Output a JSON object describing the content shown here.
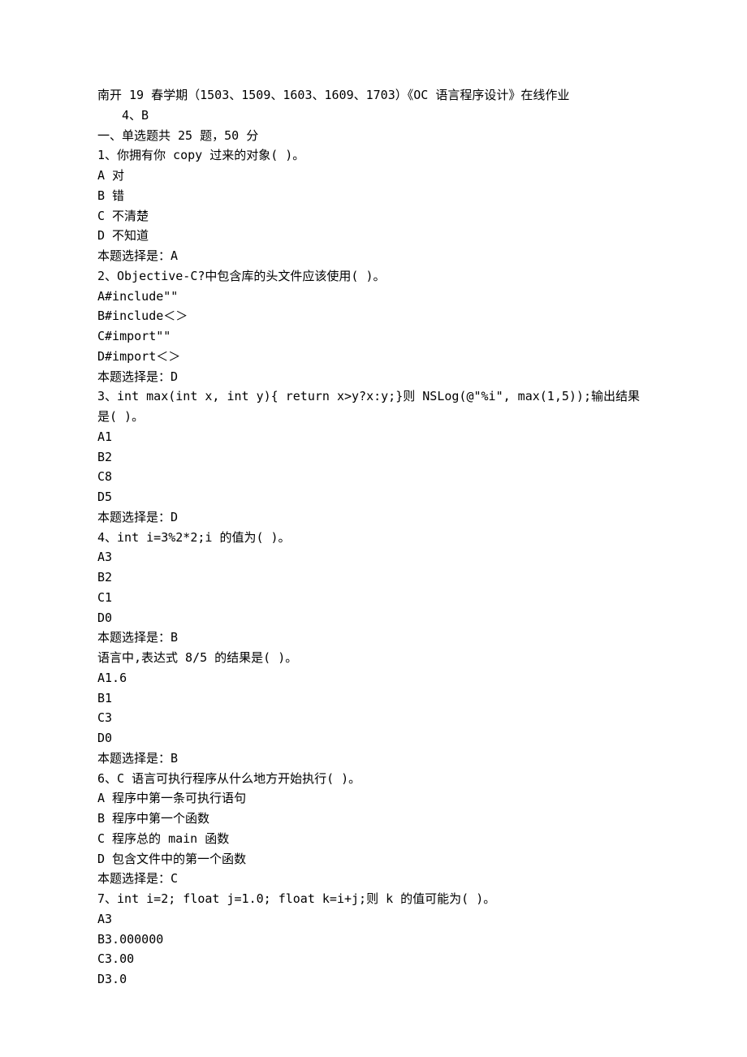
{
  "header": {
    "title": "南开 19 春学期（1503、1509、1603、1609、1703）《OC 语言程序设计》在线作业",
    "subtitle": "4、B"
  },
  "section_header": "一、单选题共 25 题，50 分",
  "questions": [
    {
      "stem": "1、你拥有你 copy 过来的对象( )。",
      "options": [
        "A 对",
        "B 错",
        "C 不清楚",
        "D 不知道"
      ],
      "answer": "本题选择是：A"
    },
    {
      "stem": "2、Objective-C?中包含库的头文件应该使用( )。",
      "options": [
        "A#include\"\"",
        "B#include＜＞",
        "C#import\"\"",
        "D#import＜＞"
      ],
      "answer": "本题选择是：D"
    },
    {
      "stem": "3、int max(int x, int y){ return x>y?x:y;}则 NSLog(@\"%i\", max(1,5));输出结果是( )。",
      "options": [
        "A1",
        "B2",
        "C8",
        "D5"
      ],
      "answer": "本题选择是：D"
    },
    {
      "stem": "4、int i=3%2*2;i 的值为( )。",
      "options": [
        "A3",
        "B2",
        "C1",
        "D0"
      ],
      "answer": "本题选择是：B"
    },
    {
      "stem": "语言中,表达式 8/5 的结果是( )。",
      "options": [
        "A1.6",
        "B1",
        "C3",
        "D0"
      ],
      "answer": "本题选择是：B"
    },
    {
      "stem": "6、C 语言可执行程序从什么地方开始执行( )。",
      "options": [
        "A 程序中第一条可执行语句",
        "B 程序中第一个函数",
        "C 程序总的 main 函数",
        "D 包含文件中的第一个函数"
      ],
      "answer": "本题选择是：C"
    },
    {
      "stem": "7、int i=2; float j=1.0; float k=i+j;则 k 的值可能为( )。",
      "options": [
        "A3",
        "B3.000000",
        "C3.00",
        "D3.0"
      ],
      "answer": ""
    }
  ]
}
